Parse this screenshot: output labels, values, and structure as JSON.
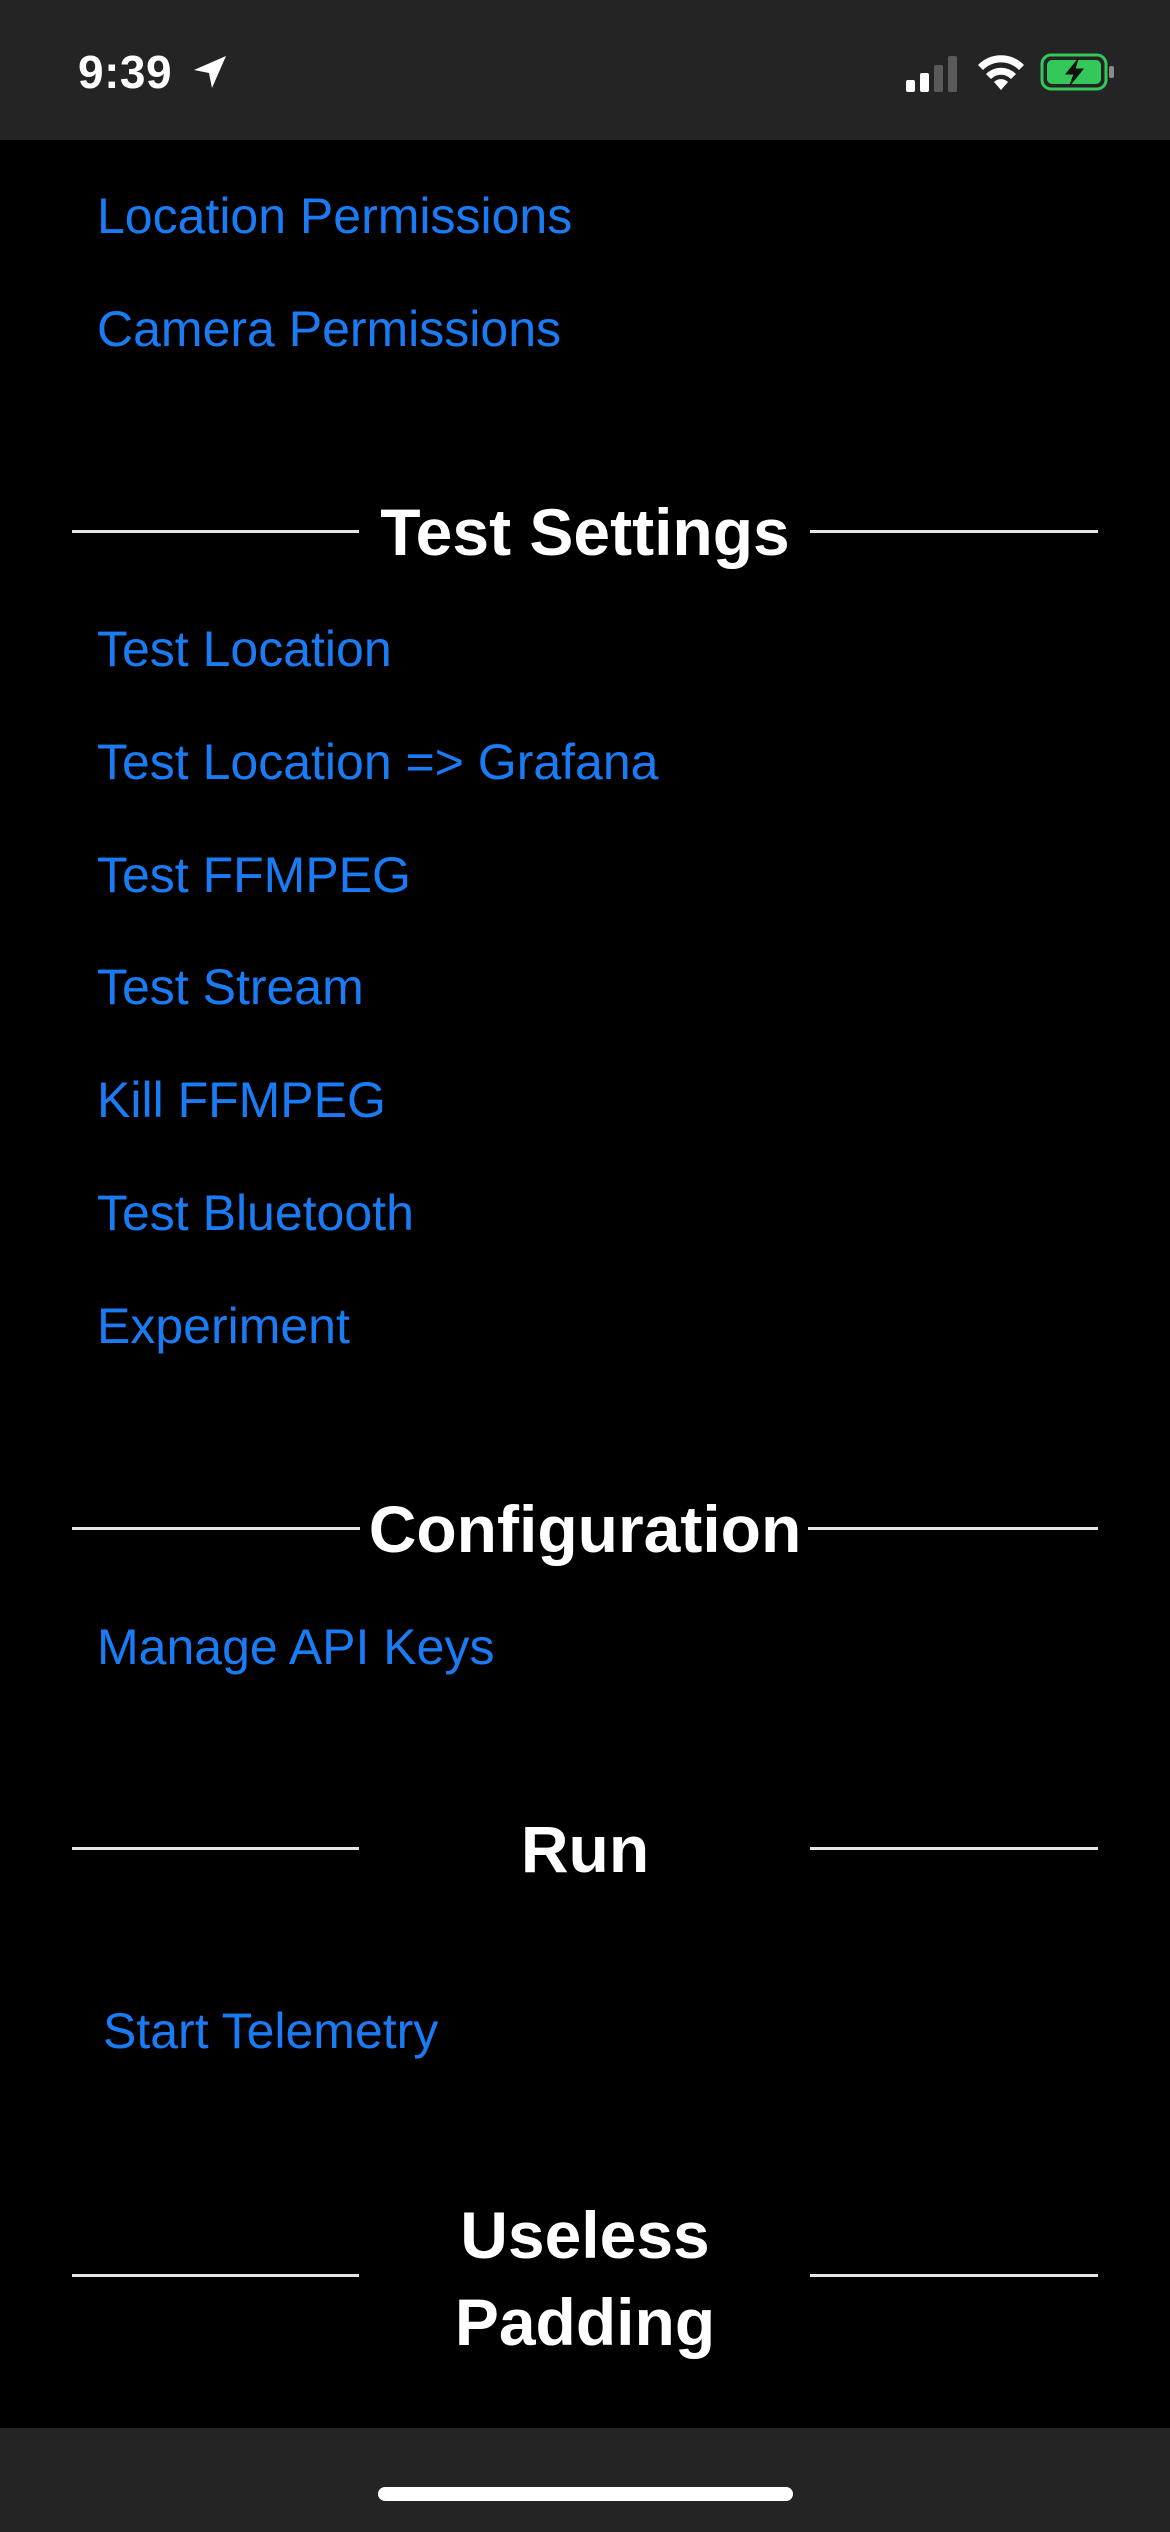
{
  "status_bar": {
    "time": "9:39"
  },
  "permissions": {
    "location_label": "Location Permissions",
    "camera_label": "Camera Permissions"
  },
  "test_settings": {
    "title": "Test Settings",
    "items": [
      "Test Location",
      "Test Location => Grafana",
      "Test FFMPEG",
      "Test Stream",
      "Kill FFMPEG",
      "Test Bluetooth",
      "Experiment"
    ]
  },
  "configuration": {
    "title": "Configuration",
    "manage_api_keys_label": "Manage API Keys"
  },
  "run": {
    "title": "Run",
    "start_telemetry_label": "Start Telemetry"
  },
  "useless_padding": {
    "title_line1": "Useless",
    "title_line2": "Padding"
  },
  "colors": {
    "link": "#1a7cf5",
    "background": "#000000",
    "bar": "#242424",
    "battery_fill": "#34c759"
  },
  "icons": [
    "location-arrow-icon",
    "cellular-signal-icon",
    "wifi-icon",
    "battery-charging-icon"
  ]
}
